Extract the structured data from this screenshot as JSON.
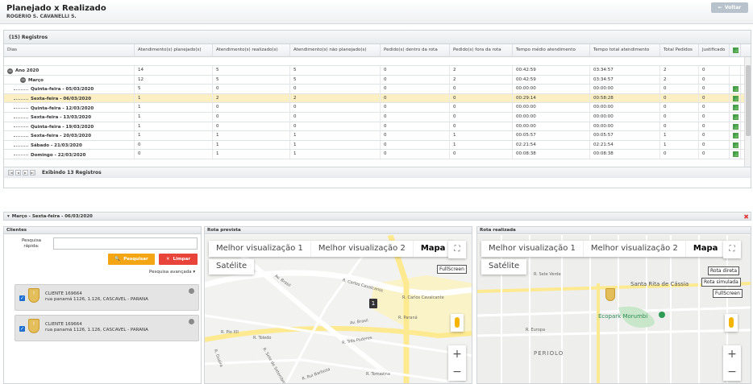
{
  "header": {
    "title": "Planejado x Realizado",
    "subtitle": "ROGERIO S. CAVANELLI S.",
    "back_label": "Voltar"
  },
  "grid": {
    "count_label": "(15) Registros",
    "columns": [
      "Dias",
      "Atendimento(s) planejado(s)",
      "Atendimento(s) realizado(s)",
      "Atendimento(s) não planejado(s)",
      "Pedido(s) dentro da rota",
      "Pedido(s) fora da rota",
      "Tempo médio atendimento",
      "Tempo total atendimento",
      "Total Pedidos",
      "Justificado"
    ],
    "rows": [
      {
        "day": "Ano 2020",
        "level": 0,
        "planned": "14",
        "done": "5",
        "unplanned": "5",
        "in_route": "0",
        "out_route": "2",
        "avg_time": "00:42:59",
        "total_time": "03:34:57",
        "orders": "2",
        "justified": "0",
        "xls": false,
        "selected": false
      },
      {
        "day": "Março",
        "level": 1,
        "planned": "12",
        "done": "5",
        "unplanned": "5",
        "in_route": "0",
        "out_route": "2",
        "avg_time": "00:42:59",
        "total_time": "03:34:57",
        "orders": "2",
        "justified": "0",
        "xls": false,
        "selected": false
      },
      {
        "day": "Quinta-feira - 05/03/2020",
        "level": 2,
        "planned": "5",
        "done": "0",
        "unplanned": "0",
        "in_route": "0",
        "out_route": "0",
        "avg_time": "00:00:00",
        "total_time": "00:00:00",
        "orders": "0",
        "justified": "0",
        "xls": true,
        "selected": false
      },
      {
        "day": "Sexta-feira - 06/03/2020",
        "level": 2,
        "planned": "1",
        "done": "2",
        "unplanned": "2",
        "in_route": "0",
        "out_route": "0",
        "avg_time": "00:29:14",
        "total_time": "00:58:28",
        "orders": "0",
        "justified": "0",
        "xls": true,
        "selected": true
      },
      {
        "day": "Quinta-feira - 12/03/2020",
        "level": 2,
        "planned": "1",
        "done": "0",
        "unplanned": "0",
        "in_route": "0",
        "out_route": "0",
        "avg_time": "00:00:00",
        "total_time": "00:00:00",
        "orders": "0",
        "justified": "0",
        "xls": true,
        "selected": false
      },
      {
        "day": "Sexta-feira - 13/03/2020",
        "level": 2,
        "planned": "1",
        "done": "0",
        "unplanned": "0",
        "in_route": "0",
        "out_route": "0",
        "avg_time": "00:00:00",
        "total_time": "00:00:00",
        "orders": "0",
        "justified": "0",
        "xls": true,
        "selected": false
      },
      {
        "day": "Quinta-feira - 19/03/2020",
        "level": 2,
        "planned": "1",
        "done": "0",
        "unplanned": "0",
        "in_route": "0",
        "out_route": "0",
        "avg_time": "00:00:00",
        "total_time": "00:00:00",
        "orders": "0",
        "justified": "0",
        "xls": true,
        "selected": false
      },
      {
        "day": "Sexta-feira - 20/03/2020",
        "level": 2,
        "planned": "1",
        "done": "1",
        "unplanned": "1",
        "in_route": "0",
        "out_route": "1",
        "avg_time": "00:05:57",
        "total_time": "00:05:57",
        "orders": "1",
        "justified": "0",
        "xls": true,
        "selected": false
      },
      {
        "day": "Sábado - 21/03/2020",
        "level": 2,
        "planned": "0",
        "done": "1",
        "unplanned": "1",
        "in_route": "0",
        "out_route": "1",
        "avg_time": "02:21:54",
        "total_time": "02:21:54",
        "orders": "1",
        "justified": "0",
        "xls": true,
        "selected": false
      },
      {
        "day": "Domingo - 22/03/2020",
        "level": 2,
        "planned": "0",
        "done": "1",
        "unplanned": "1",
        "in_route": "0",
        "out_route": "0",
        "avg_time": "00:08:38",
        "total_time": "00:08:38",
        "orders": "0",
        "justified": "0",
        "xls": true,
        "selected": false
      }
    ],
    "footer_label": "Exibindo 13 Registros"
  },
  "detail": {
    "title": "Março - Sexta-feira - 06/03/2020"
  },
  "clients": {
    "header": "Clientes",
    "quick_search_label": "Pesquisa rápida:",
    "quick_search_value": "",
    "search_label": "Pesquisar",
    "clear_label": "Limpar",
    "advanced_label": "Pesquisa avançada",
    "items": [
      {
        "name": "CLIENTE 169664",
        "address": "rua panamá 1126, 1.126, CASCAVEL - PARANA"
      },
      {
        "name": "CLIENTE 169664",
        "address": "rua panamá 1126, 1.126, CASCAVEL - PARANA"
      }
    ]
  },
  "planned_map": {
    "header": "Rota prevista",
    "map_types": [
      "Melhor visualização 1",
      "Melhor visualização 2",
      "Mapa"
    ],
    "satellite": "Satélite",
    "fullscreen_tag": "FullScreen",
    "marker": "1",
    "labels": [
      "Av. Brasil",
      "R. Carlos Cavalcante",
      "R. Carlos Cavalcante",
      "Av. Brasil",
      "R. Paraná",
      "R. Pio XII",
      "R. Toledo",
      "R. Guaíra",
      "R. Três Poderes",
      "R. Tomazina",
      "R. Rui Barbosa",
      "R. Sete de Setembro"
    ]
  },
  "actual_map": {
    "header": "Rota realizada",
    "map_types": [
      "Melhor visualização 1",
      "Melhor visualização 2",
      "Mapa"
    ],
    "satellite": "Satélite",
    "tags": [
      "Rota direta",
      "Rota simulada",
      "FullScreen"
    ],
    "labels": [
      "Santa Rita de Cássia",
      "Ecopark Morumbi",
      "R. Europa",
      "PERIOLO",
      "R. Sete Verde"
    ]
  }
}
